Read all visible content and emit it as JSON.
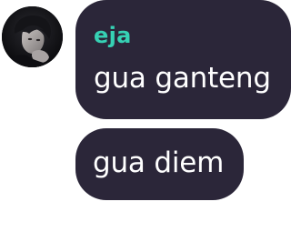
{
  "conversation": {
    "messages": [
      {
        "sender": "eja",
        "text": "gua ganteng",
        "avatar": "profile-photo"
      },
      {
        "text": "gua diem"
      }
    ]
  },
  "colors": {
    "bubble_background": "#2b2639",
    "sender_name": "#36d1b4",
    "message_text": "#ffffff",
    "page_background": "#ffffff"
  }
}
